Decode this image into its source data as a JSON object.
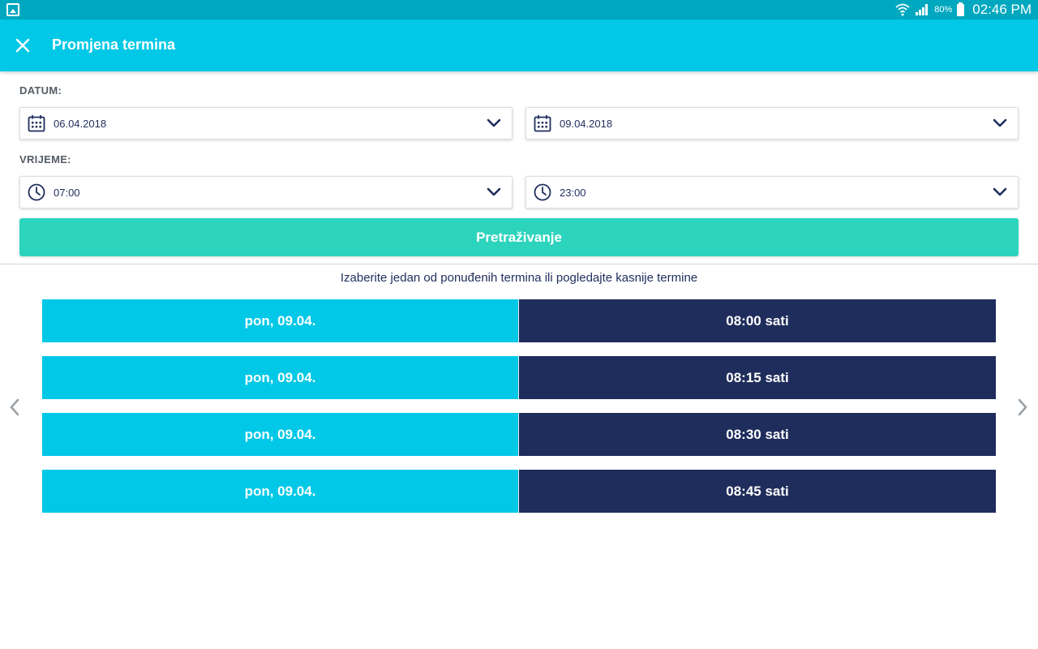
{
  "status_bar": {
    "battery_percent": "80%",
    "time": "02:46 PM",
    "icons": [
      "gallery-icon",
      "wifi-icon",
      "signal-icon",
      "battery-icon"
    ]
  },
  "app_bar": {
    "title": "Promjena termina",
    "close_icon": "close-icon",
    "background": "#00c8e6"
  },
  "filters": {
    "date_label": "DATUM:",
    "date_from": "06.04.2018",
    "date_to": "09.04.2018",
    "time_label": "VRIJEME:",
    "time_from": "07:00",
    "time_to": "23:00"
  },
  "search_button": {
    "label": "Pretraživanje",
    "color": "#2dd4bd"
  },
  "results": {
    "hint": "Izaberite jedan od ponuđenih termina ili pogledajte kasnije termine",
    "slots": [
      {
        "day": "pon, 09.04.",
        "time": "08:00 sati"
      },
      {
        "day": "pon, 09.04.",
        "time": "08:15 sati"
      },
      {
        "day": "pon, 09.04.",
        "time": "08:30 sati"
      },
      {
        "day": "pon, 09.04.",
        "time": "08:45 sati"
      }
    ],
    "day_color": "#00c8e6",
    "time_color": "#1f2d5c"
  }
}
